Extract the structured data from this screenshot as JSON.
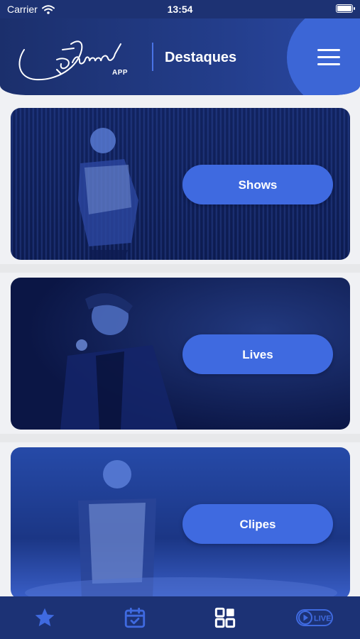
{
  "status_bar": {
    "carrier": "Carrier",
    "time": "13:54"
  },
  "header": {
    "logo_text": "Daniel",
    "logo_badge": "APP",
    "title": "Destaques"
  },
  "cards": [
    {
      "label": "Shows"
    },
    {
      "label": "Lives"
    },
    {
      "label": "Clipes"
    }
  ],
  "tabbar": {
    "items": [
      {
        "icon": "star-icon"
      },
      {
        "icon": "calendar-check-icon"
      },
      {
        "icon": "grid-icon",
        "active": true
      },
      {
        "icon": "live-icon",
        "label": "LIVE"
      }
    ]
  },
  "colors": {
    "primary": "#1d3273",
    "accent": "#3f6ae0",
    "menu": "#3c66d6"
  }
}
